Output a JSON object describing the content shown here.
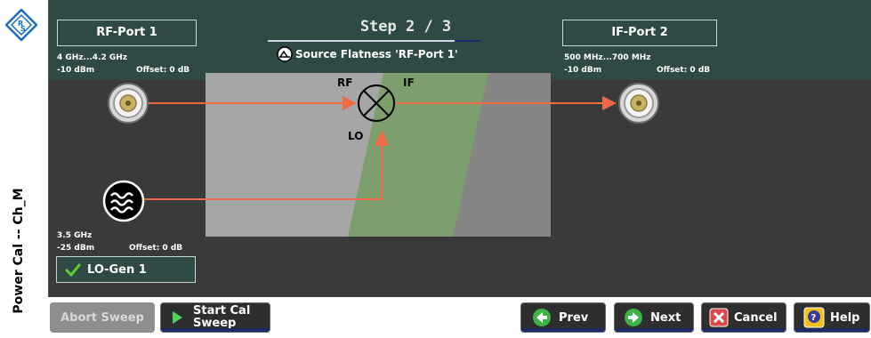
{
  "sidebar": {
    "vertical_label": "Power Cal -- Ch_M"
  },
  "header": {
    "step_title": "Step 2 / 3",
    "step_subtitle": "Source Flatness 'RF-Port 1'"
  },
  "rf_port": {
    "label": "RF-Port 1",
    "freq": "4 GHz...4.2 GHz",
    "power": "-10 dBm",
    "offset": "Offset: 0 dB"
  },
  "if_port": {
    "label": "IF-Port 2",
    "freq": "500 MHz...700 MHz",
    "power": "-10 dBm",
    "offset": "Offset: 0 dB"
  },
  "lo": {
    "freq": "3.5 GHz",
    "power": "-25 dBm",
    "offset": "Offset: 0 dB",
    "generator_label": "LO-Gen 1"
  },
  "mixer": {
    "rf_label": "RF",
    "if_label": "IF",
    "lo_label": "LO"
  },
  "buttons": {
    "abort": "Abort Sweep",
    "start_cal_line1": "Start Cal",
    "start_cal_line2": "Sweep",
    "prev": "Prev",
    "next": "Next",
    "cancel": "Cancel",
    "help": "Help"
  },
  "colors": {
    "panel_bg": "#3a3a3a",
    "header_band": "#2f4a44",
    "arrow": "#ef6a45",
    "green_band": "#7aa06a",
    "accent_navy": "#1f2a6a"
  }
}
